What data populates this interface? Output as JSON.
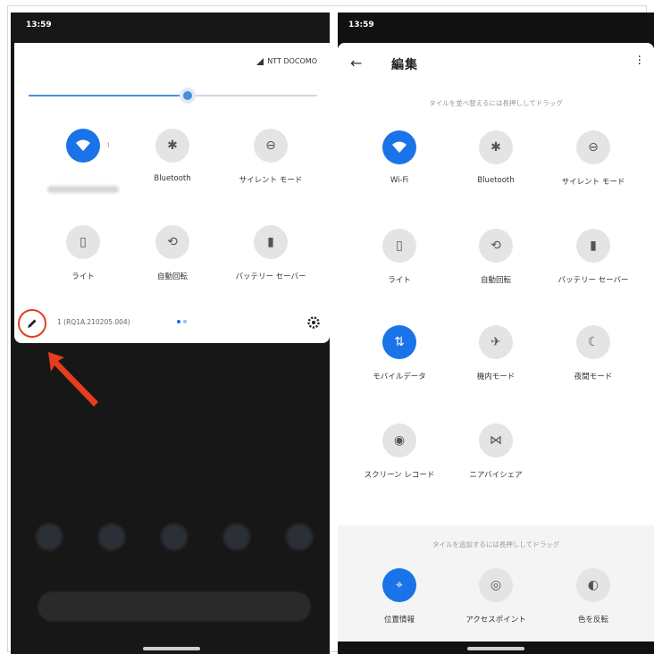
{
  "left": {
    "status_time": "13:59",
    "carrier": "NTT DOCOMO",
    "brightness_level": 0.55,
    "tiles": [
      {
        "label": "",
        "icon": "wifi-icon",
        "active": true
      },
      {
        "label": "Bluetooth",
        "icon": "bluetooth-icon",
        "active": false
      },
      {
        "label": "サイレント モード",
        "icon": "do-not-disturb-icon",
        "active": false
      },
      {
        "label": "ライト",
        "icon": "flashlight-icon",
        "active": false
      },
      {
        "label": "自動回転",
        "icon": "auto-rotate-icon",
        "active": false
      },
      {
        "label": "バッテリー セーバー",
        "icon": "battery-saver-icon",
        "active": false
      }
    ],
    "build": "1 (RQ1A.210205.004)",
    "page_dots": 2,
    "edit_icon": "pencil-icon",
    "settings_icon": "gear-icon"
  },
  "right": {
    "status_time": "13:59",
    "title": "編集",
    "hint_top": "タイルを並べ替えるには長押ししてドラッグ",
    "hint_bottom": "タイルを追加するには長押ししてドラッグ",
    "tiles": [
      {
        "label": "Wi-Fi",
        "icon": "wifi-icon",
        "active": true
      },
      {
        "label": "Bluetooth",
        "icon": "bluetooth-icon",
        "active": false
      },
      {
        "label": "サイレント モード",
        "icon": "do-not-disturb-icon",
        "active": false
      },
      {
        "label": "ライト",
        "icon": "flashlight-icon",
        "active": false
      },
      {
        "label": "自動回転",
        "icon": "auto-rotate-icon",
        "active": false
      },
      {
        "label": "バッテリー セーバー",
        "icon": "battery-saver-icon",
        "active": false
      },
      {
        "label": "モバイルデータ",
        "icon": "mobile-data-icon",
        "active": true
      },
      {
        "label": "機内モード",
        "icon": "airplane-icon",
        "active": false
      },
      {
        "label": "夜間モード",
        "icon": "moon-icon",
        "active": false
      },
      {
        "label": "スクリーン レコード",
        "icon": "screen-record-icon",
        "active": false
      },
      {
        "label": "ニアバイシェア",
        "icon": "nearby-share-icon",
        "active": false
      }
    ],
    "add_tiles": [
      {
        "label": "位置情報",
        "icon": "location-icon",
        "active": true
      },
      {
        "label": "アクセスポイント",
        "icon": "hotspot-icon",
        "active": false
      },
      {
        "label": "色を反転",
        "icon": "invert-colors-icon",
        "active": false
      }
    ]
  },
  "colors": {
    "accent": "#1a73e8",
    "highlight": "#e53d1e"
  }
}
